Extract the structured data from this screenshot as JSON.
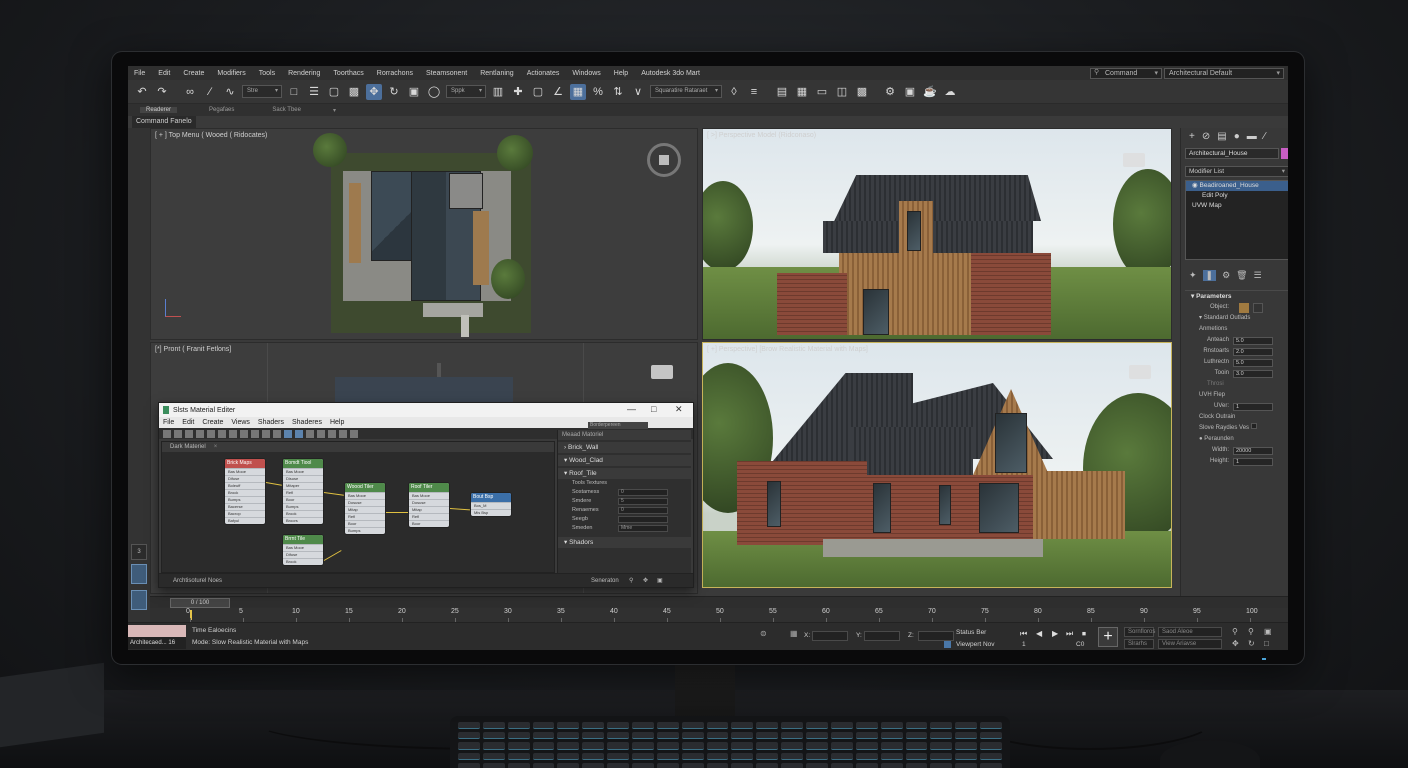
{
  "app": {
    "menu": [
      "File",
      "Edit",
      "Create",
      "Modifiers",
      "Tools",
      "Rendering",
      "Toorthacs",
      "Rorrachons",
      "Steamsonent",
      "Rentlaning",
      "Actionates",
      "Windows",
      "Help",
      "Autodesk 3do Mart"
    ],
    "command_label": "Command",
    "workspace_label": "Architectural Default"
  },
  "toolbar": {
    "selection_filter": "Stre",
    "snap_dropdown": "Sppk",
    "named_selection": "Squaratire Rataraet",
    "ribbon_tabs": [
      "Readerer",
      "Pegafaes",
      "Sack Tbee"
    ],
    "command_panel_tab": "Command Fanelo"
  },
  "viewports": {
    "top_label": "[ + ] Top Menu ( Wooed ( Ridocates)",
    "persp1_label": "[ >] Perspective Model (Ridconaso)",
    "front_label": "[*] Pront ( Franit Fetlons]",
    "persp2_label": "[ +] Perspective] [Brow Realistic Material with Maps]"
  },
  "left_strip": {
    "btn3": "3"
  },
  "material_editor": {
    "title": "Slsts Material Editer",
    "menu": [
      "File",
      "Edit",
      "Create",
      "Views",
      "Shaders",
      "Shaderes",
      "Help"
    ],
    "view_tab": "Dark Materiel",
    "nav_field": "Borderpereen",
    "right_header": "Meaad Matoriel",
    "rows": [
      "Brick_Wall",
      "Wood_Clad",
      "Roof_Tile",
      "Shadors"
    ],
    "sub_header": "Tools Textures",
    "sub_rows": [
      {
        "label": "Sostamess",
        "value": "0"
      },
      {
        "label": "Smdere",
        "value": "5"
      },
      {
        "label": "Renaemes",
        "value": "0"
      },
      {
        "label": "Seegb",
        "value": ""
      },
      {
        "label": "Smeden",
        "value": "Mme"
      }
    ],
    "status": "Archtisoturel Noes",
    "status_right": "Seneraton",
    "nodes": [
      {
        "title": "Brick Maps",
        "color": "#c0504d",
        "rows": [
          "Bas Mooe",
          "Difuse",
          "Boleuff",
          "Brock",
          "Bumps",
          "Bacerse",
          "Bacrop",
          "Bafyul"
        ]
      },
      {
        "title": "Bomdt Tiool",
        "color": "#4f8a4a",
        "rows": [
          "Bas Mooe",
          "Disuse",
          "Mitaper",
          "Refl",
          "Boor",
          "Bumps",
          "Brook",
          "Broors"
        ]
      },
      {
        "title": "Woood Tiler",
        "color": "#4f8a4a",
        "rows": [
          "Bas Mooe",
          "Dosuse",
          "Mitap",
          "Refl",
          "Boor",
          "Bumps"
        ]
      },
      {
        "title": "Roof Tiler",
        "color": "#4f8a4a",
        "rows": [
          "Bas Mooe",
          "Dosuse",
          "Mitap",
          "Refl",
          "Boor"
        ]
      },
      {
        "title": "Brrnt Tile",
        "color": "#4f8a4a",
        "rows": [
          "Bas Mooe",
          "Difuse",
          "Brook"
        ]
      },
      {
        "title": "Bout Bsp",
        "color": "#3b6fa8",
        "rows": [
          "Bos_M",
          "Mis Bsp"
        ]
      }
    ]
  },
  "command_panel": {
    "object_name": "Architectural_House",
    "modifier_list": "Modifier List",
    "stack": [
      "Beadiroaned_House",
      "Edit Poly",
      "UVW Map"
    ],
    "params_title": "Parameters",
    "object_label": "Object:",
    "section": "Standard Outlads",
    "group1": "Anmetions",
    "params1": [
      {
        "label": "Anteach",
        "value": "5.0"
      },
      {
        "label": "Rnstoarts",
        "value": "2.0"
      },
      {
        "label": "Luthrectn",
        "value": "5.0"
      },
      {
        "label": "Tooin",
        "value": "3.0"
      }
    ],
    "params1_extra": "Throsi",
    "group2": "UVH Flep",
    "uv_label": "UVer:",
    "uv_value": "1",
    "group3": "Clock Outrain",
    "check1": "Slove Raydies Ves",
    "group4": "Peraunden",
    "width_label": "Width:",
    "width_value": "20000",
    "height_label": "Height:",
    "height_value": "1"
  },
  "timeline": {
    "frame_display": "0 / 100",
    "ticks": [
      "0",
      "5",
      "10",
      "15",
      "20",
      "25",
      "30",
      "35",
      "40",
      "45",
      "50",
      "55",
      "60",
      "65",
      "70",
      "75",
      "80",
      "85",
      "90",
      "95",
      "100"
    ]
  },
  "status": {
    "mini_label": "Architecaed... 16",
    "line1": "Time Ealoecins",
    "line2": "Mode: Slow Realistic Material with Maps",
    "status_bar_label": "Status Ber",
    "viewport_nav": "Viewpert Nov",
    "frame_field": "1",
    "frame_field2": "C0",
    "right1": "Sornfloros",
    "right2": "Slrarhs",
    "right3": "Saod Aleoe",
    "right4": "View Ariavse",
    "x_label": "X:",
    "y_label": "Y:",
    "z_label": "Z:"
  }
}
